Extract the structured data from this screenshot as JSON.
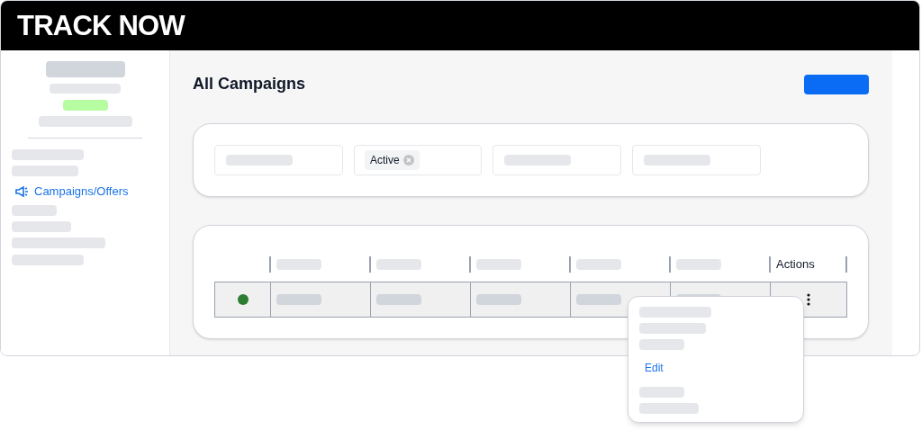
{
  "header": {
    "logo": "TRACK NOW"
  },
  "sidebar": {
    "items": [
      {
        "label": "Campaigns/Offers",
        "selected": true
      }
    ]
  },
  "main": {
    "title": "All Campaigns",
    "filters": [
      {
        "kind": "empty"
      },
      {
        "kind": "chip",
        "chip": "Active"
      },
      {
        "kind": "empty"
      },
      {
        "kind": "empty"
      }
    ],
    "table": {
      "columns": [
        {
          "kind": "status"
        },
        {
          "kind": "blank"
        },
        {
          "kind": "blank"
        },
        {
          "kind": "blank"
        },
        {
          "kind": "blank"
        },
        {
          "kind": "blank"
        },
        {
          "kind": "label",
          "label": "Actions"
        }
      ],
      "rows": [
        {
          "color": "#2e7d32"
        }
      ]
    }
  },
  "row_menu": {
    "items": [
      {
        "kind": "blank"
      },
      {
        "kind": "blank"
      },
      {
        "kind": "blank"
      },
      {
        "kind": "link",
        "label": "Edit"
      },
      {
        "kind": "blank"
      },
      {
        "kind": "blank"
      }
    ]
  }
}
